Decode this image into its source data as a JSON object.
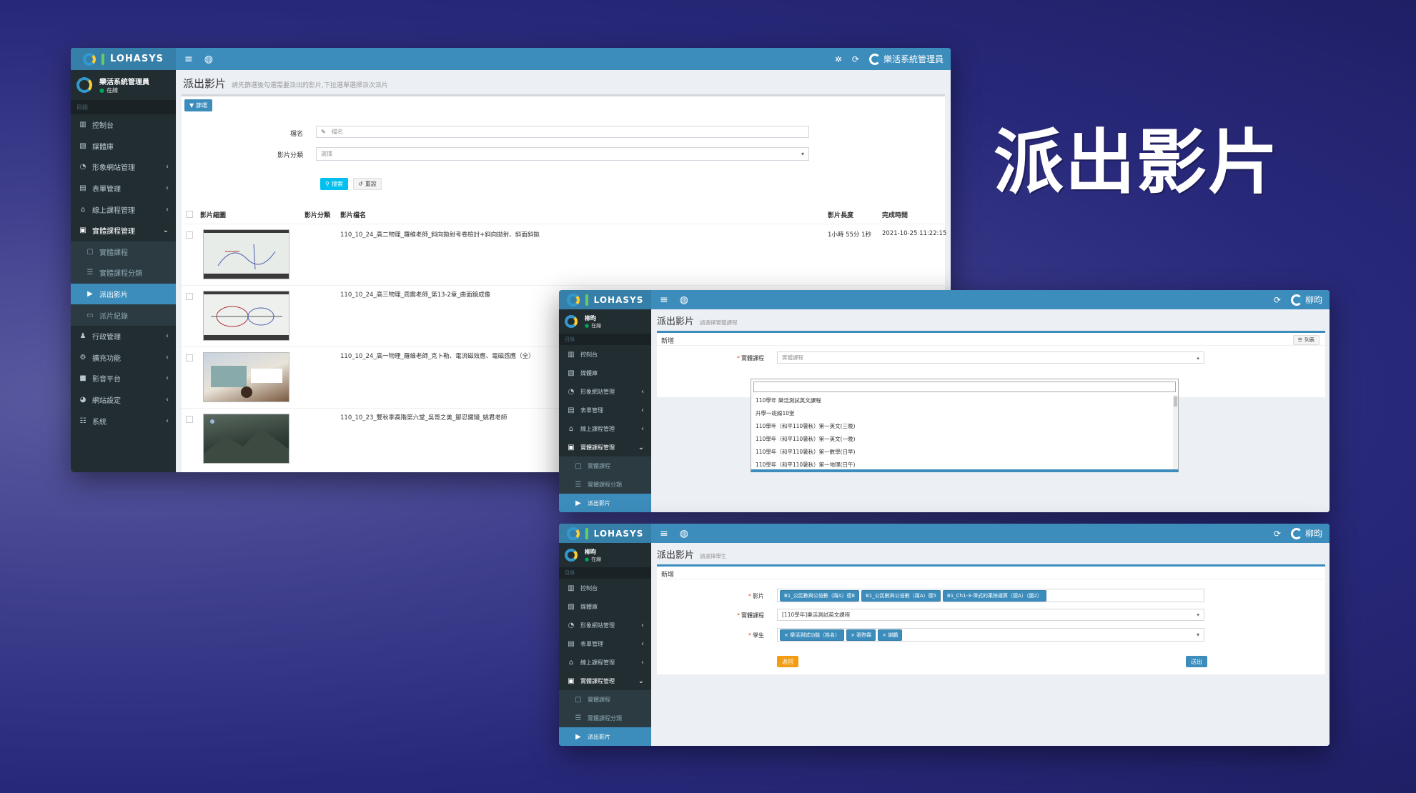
{
  "headline": "派出影片",
  "brand": {
    "name": "LOHASYS"
  },
  "colors": {
    "primary": "#3c8dbc",
    "sidebar": "#222d32",
    "active": "#3c8dbc"
  },
  "win1": {
    "user": {
      "name": "樂活系統管理員",
      "status": "在線"
    },
    "topbar_user": "樂活系統管理員",
    "menu_header": "目錄",
    "menu": [
      {
        "label": "控制台",
        "icon": "chart-icon"
      },
      {
        "label": "媒體庫",
        "icon": "image-icon"
      },
      {
        "label": "形象網站管理",
        "icon": "globe-icon"
      },
      {
        "label": "表單管理",
        "icon": "form-icon"
      },
      {
        "label": "線上課程管理",
        "icon": "bank-icon"
      },
      {
        "label": "實體課程管理",
        "icon": "edit-icon"
      },
      {
        "label": "實體課程",
        "icon": "square-icon"
      },
      {
        "label": "實體課程分類",
        "icon": "list-icon"
      },
      {
        "label": "派出影片",
        "icon": "video-icon"
      },
      {
        "label": "派片紀錄",
        "icon": "monitor-icon"
      },
      {
        "label": "行政管理",
        "icon": "user-icon"
      },
      {
        "label": "擴充功能",
        "icon": "gears-icon"
      },
      {
        "label": "影音平台",
        "icon": "camera-icon"
      },
      {
        "label": "網站設定",
        "icon": "globe-icon"
      },
      {
        "label": "系統",
        "icon": "list-icon"
      }
    ],
    "title": "派出影片",
    "subtitle": "請先篩選後勾選需要派出的影片,下拉選單選擇派次派片",
    "filter_btn": "篩選",
    "form": {
      "filename_label": "檔名",
      "filename_placeholder": "檔名",
      "category_label": "影片分類",
      "category_value": "選擇",
      "search_btn": "搜索",
      "reset_btn": "重設"
    },
    "columns": [
      "影片縮圖",
      "影片分類",
      "影片檔名",
      "影片長度",
      "完成時間"
    ],
    "rows": [
      {
        "name": "110_10_24_高二物理_羅維老師_斜向拋射考卷檢討+斜向拋射、斜面斜拋",
        "duration": "1小時 55分 1秒",
        "time": "2021-10-25 11:22:15"
      },
      {
        "name": "110_10_24_高三物理_周震老師_第13-2章_曲面鏡成像",
        "duration": "",
        "time": ""
      },
      {
        "name": "110_10_24_高一物理_羅維老師_克卜勒、電流磁效應、電磁感應（全）",
        "duration": "",
        "time": ""
      },
      {
        "name": "110_10_23_雙秋季高階第六堂_吳哥之美_鄒忍鐵鏈_姚君老師",
        "duration": "",
        "time": ""
      }
    ]
  },
  "win2": {
    "user": {
      "name": "柳昀",
      "status": "在線"
    },
    "topbar_user": "柳昀",
    "menu_header": "目錄",
    "menu": [
      {
        "label": "控制台"
      },
      {
        "label": "媒體庫"
      },
      {
        "label": "形象網站管理"
      },
      {
        "label": "表單管理"
      },
      {
        "label": "線上課程管理"
      },
      {
        "label": "實體課程管理"
      },
      {
        "label": "實體課程"
      },
      {
        "label": "實體課程分類"
      },
      {
        "label": "派出影片"
      }
    ],
    "title": "派出影片",
    "subtitle": "請選擇實體課程",
    "panel_title": "新增",
    "list_btn": "列表",
    "course_label": "實體課程",
    "course_placeholder": "實體課程",
    "options": [
      "110學年 樂活測試英文課程",
      "升學一班線10堂",
      "110學年（和平110暑秋）第一英文(三晚)",
      "110學年（和平110暑秋）第一英文(一晚)",
      "110學年（和平110暑秋）第一數學(日早)",
      "110學年（和平110暑秋）第一地理(日午)"
    ]
  },
  "win3": {
    "user": {
      "name": "柳昀",
      "status": "在線"
    },
    "topbar_user": "柳昀",
    "menu_header": "目錄",
    "menu": [
      {
        "label": "控制台"
      },
      {
        "label": "媒體庫"
      },
      {
        "label": "形象網站管理"
      },
      {
        "label": "表單管理"
      },
      {
        "label": "線上課程管理"
      },
      {
        "label": "實體課程管理"
      },
      {
        "label": "實體課程"
      },
      {
        "label": "實體課程分類"
      },
      {
        "label": "派出影片"
      }
    ],
    "title": "派出影片",
    "subtitle": "請選擇學生",
    "panel_title": "新增",
    "video_label": "影片",
    "videos": [
      "B1_公民數與公倍數（兩A）德8",
      "B1_公民數與公倍數（兩A）德5",
      "B1_Ch1-3-澤式的乘除運算（德A）（國2）"
    ],
    "course_label": "實體課程",
    "course_value": "[110學年]樂活測試英文課程",
    "student_label": "學生",
    "students": [
      "× 樂活測試功能（姓名）",
      "× 張煦霖",
      "× 謝鵬"
    ],
    "back_btn": "返回",
    "submit_btn": "送出"
  }
}
